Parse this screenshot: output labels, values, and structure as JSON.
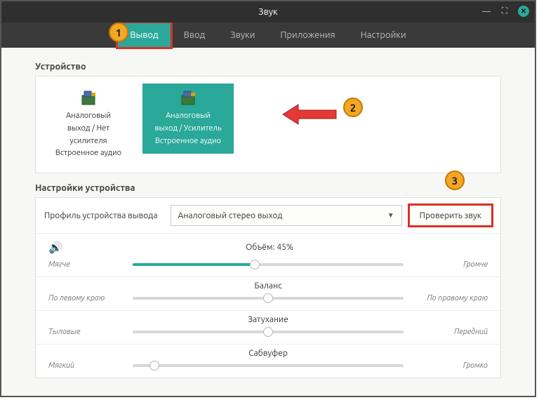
{
  "window": {
    "title": "Звук"
  },
  "tabs": {
    "output": "Вывод",
    "input": "Ввод",
    "sounds": "Звуки",
    "apps": "Приложения",
    "settings": "Настройки"
  },
  "sections": {
    "device": "Устройство",
    "device_settings": "Настройки устройства"
  },
  "devices": [
    {
      "line1": "Аналоговый",
      "line2": "выход / Нет",
      "line3": "усилителя",
      "line4": "Встроенное аудио"
    },
    {
      "line1": "Аналоговый",
      "line2": "выход / Усилитель",
      "line3": "Встроенное аудио",
      "line4": ""
    }
  ],
  "profile": {
    "label": "Профиль устройства вывода",
    "value": "Аналоговый стерео выход",
    "test_button": "Проверить звук"
  },
  "sliders": {
    "volume": {
      "title": "Объём: 45%",
      "left": "Мягче",
      "right": "Громче",
      "percent": 45
    },
    "balance": {
      "title": "Баланс",
      "left": "По левому краю",
      "right": "По правому краю",
      "percent": 50
    },
    "fade": {
      "title": "Затухание",
      "left": "Тыловые",
      "right": "Передний",
      "percent": 50
    },
    "sub": {
      "title": "Сабвуфер",
      "left": "Мягкий",
      "right": "Громко",
      "percent": 8
    }
  },
  "annotations": {
    "b1": "1",
    "b2": "2",
    "b3": "3"
  }
}
